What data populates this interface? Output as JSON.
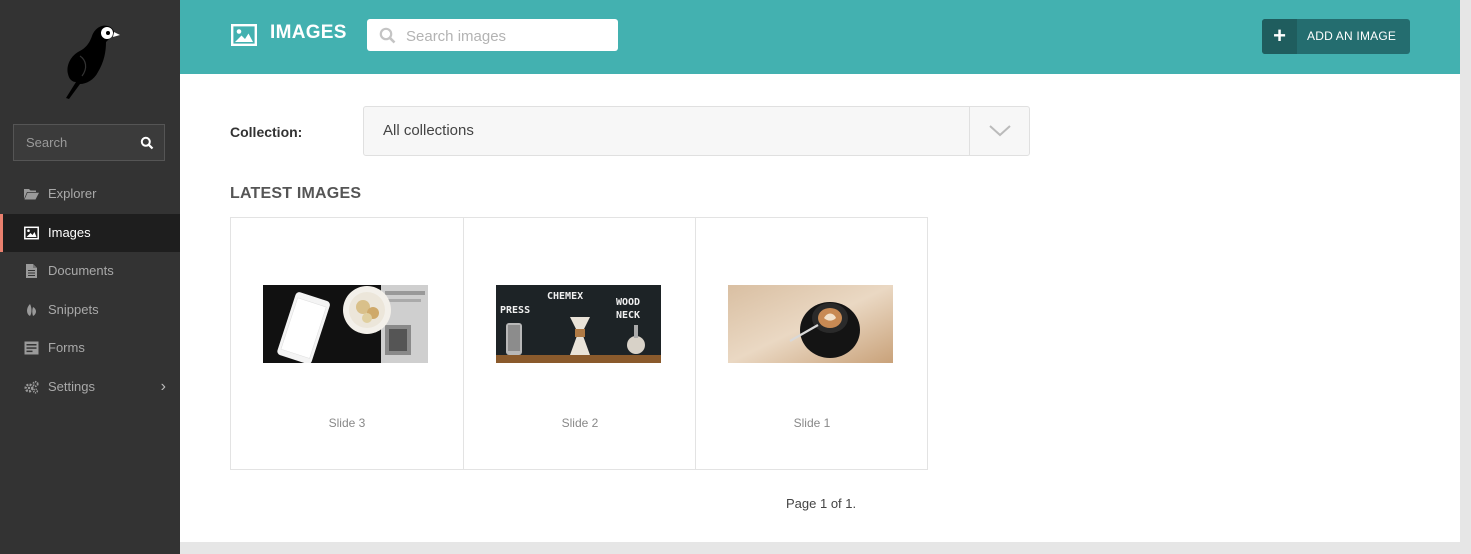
{
  "sidebar": {
    "search_placeholder": "Search",
    "items": [
      {
        "label": "Explorer",
        "icon": "folder-icon"
      },
      {
        "label": "Images",
        "icon": "image-icon",
        "active": true
      },
      {
        "label": "Documents",
        "icon": "document-icon"
      },
      {
        "label": "Snippets",
        "icon": "snippet-icon"
      },
      {
        "label": "Forms",
        "icon": "form-icon"
      },
      {
        "label": "Settings",
        "icon": "cogs-icon",
        "has_submenu": true
      }
    ]
  },
  "header": {
    "title": "IMAGES",
    "search_placeholder": "Search images",
    "add_button_label": "ADD AN IMAGE"
  },
  "filters": {
    "collection_label": "Collection:",
    "collection_value": "All collections"
  },
  "section_title": "LATEST IMAGES",
  "images": [
    {
      "title": "Slide 3"
    },
    {
      "title": "Slide 2"
    },
    {
      "title": "Slide 1"
    }
  ],
  "thumb_text": {
    "chemex": "CHEMEX",
    "press": "PRESS",
    "wood": "WOOD",
    "neck": "NECK"
  },
  "pagination": "Page 1 of 1.",
  "colors": {
    "header": "#43b1b0",
    "sidebar": "#333333",
    "active_marker": "#e9806e",
    "button": "#246d6f"
  }
}
